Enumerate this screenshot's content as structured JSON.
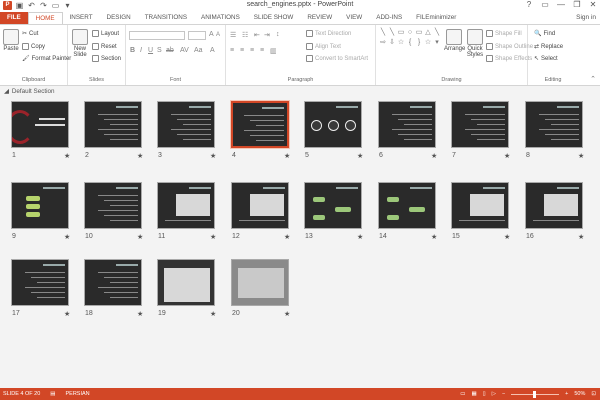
{
  "window": {
    "title": "search_engines.pptx - PowerPoint",
    "help": "?",
    "min": "—",
    "max": "❐",
    "close": "✕"
  },
  "tabs": {
    "items": [
      "FILE",
      "HOME",
      "INSERT",
      "DESIGN",
      "TRANSITIONS",
      "ANIMATIONS",
      "SLIDE SHOW",
      "REVIEW",
      "VIEW",
      "ADD-INS",
      "FILEminimizer"
    ],
    "active": "HOME",
    "sign_in": "Sign in"
  },
  "ribbon": {
    "clipboard": {
      "label": "Clipboard",
      "paste": "Paste",
      "cut": "Cut",
      "copy": "Copy",
      "format_painter": "Format Painter"
    },
    "slides": {
      "label": "Slides",
      "new_slide": "New Slide",
      "layout": "Layout",
      "reset": "Reset",
      "section": "Section"
    },
    "font": {
      "label": "Font"
    },
    "paragraph": {
      "label": "Paragraph",
      "text_direction": "Text Direction",
      "align_text": "Align Text",
      "convert_smartart": "Convert to SmartArt"
    },
    "drawing": {
      "label": "Drawing",
      "arrange": "Arrange",
      "quick_styles": "Quick Styles",
      "shape_fill": "Shape Fill",
      "shape_outline": "Shape Outline",
      "shape_effects": "Shape Effects"
    },
    "editing": {
      "label": "Editing",
      "find": "Find",
      "replace": "Replace",
      "select": "Select"
    }
  },
  "sorter": {
    "section_name": "Default Section",
    "selected_slide": 4,
    "slides": [
      "1",
      "2",
      "3",
      "4",
      "5",
      "6",
      "7",
      "8",
      "9",
      "10",
      "11",
      "12",
      "13",
      "14",
      "15",
      "16",
      "17",
      "18",
      "19",
      "20"
    ]
  },
  "status": {
    "slide_info": "SLIDE 4 OF 20",
    "language": "PERSIAN",
    "zoom": "50%"
  },
  "colors": {
    "accent": "#d24726"
  }
}
